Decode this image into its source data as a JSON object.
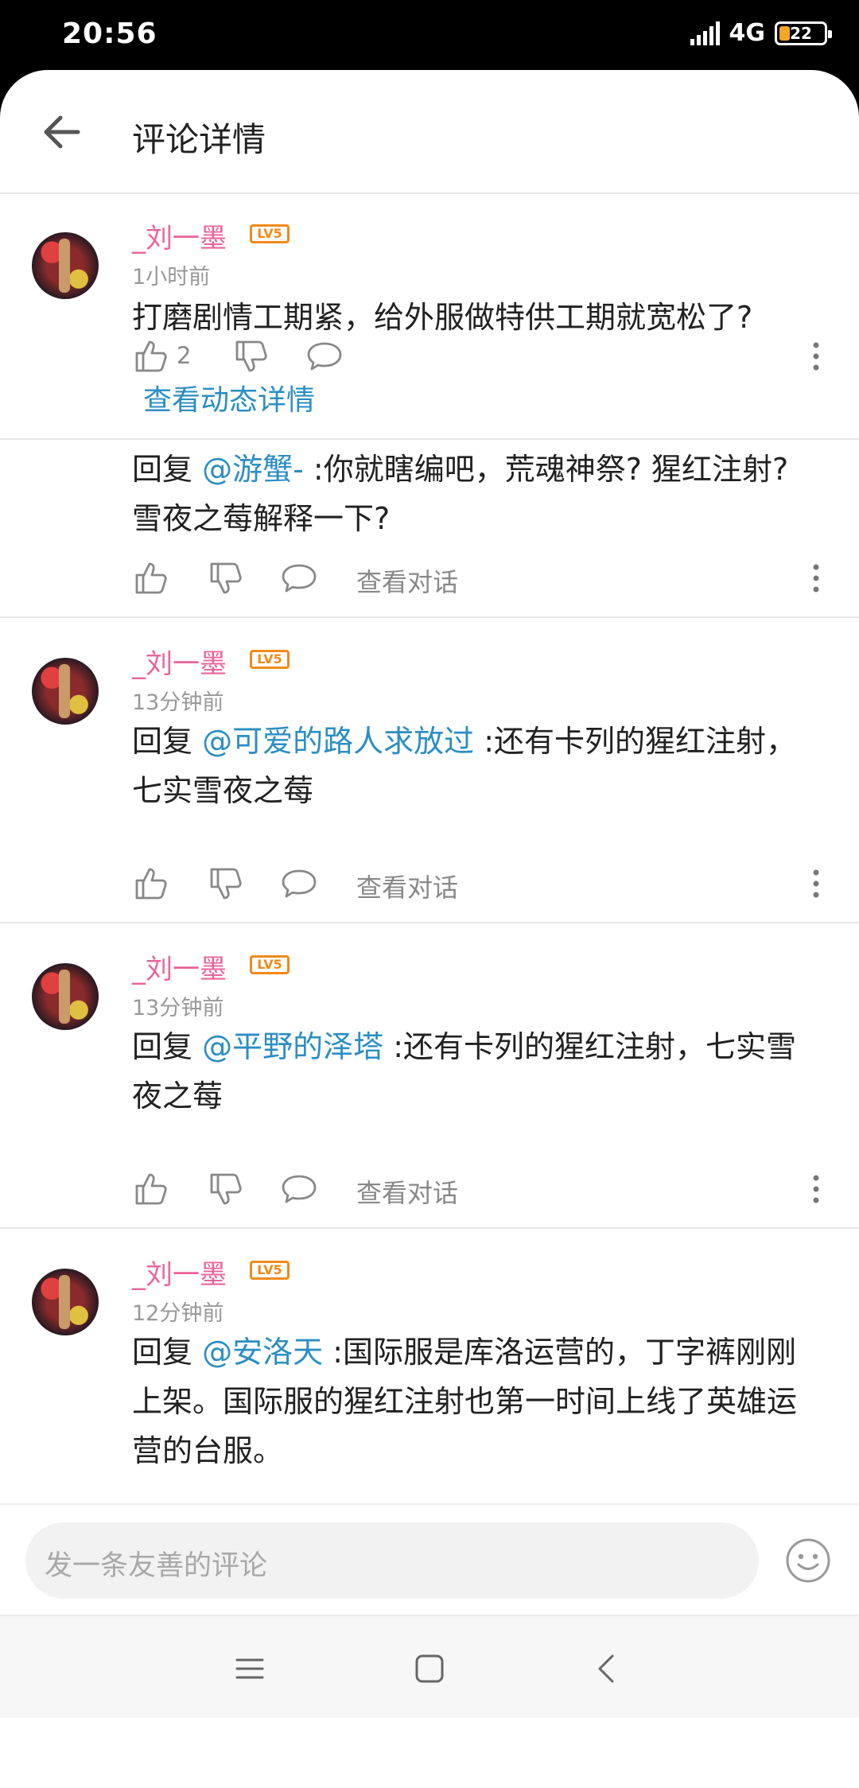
{
  "status": {
    "time": "20:56",
    "network": "4G",
    "battery": "22",
    "battery_fraction": 0.22
  },
  "header": {
    "title": "评论详情"
  },
  "main_comment": {
    "username": "_刘一墨",
    "level": "LV5",
    "time": "1小时前",
    "text": "打磨剧情工期紧，给外服做特供工期就宽松了?",
    "like_count": "2",
    "detail_link": "查看动态详情"
  },
  "replies": [
    {
      "prefix": "回复 ",
      "mention": "@游蟹-",
      "text": " :你就瞎编吧，荒魂神祭? 猩红注射? 雪夜之莓解释一下?",
      "talk_label": "查看对话"
    },
    {
      "username": "_刘一墨",
      "level": "LV5",
      "time": "13分钟前",
      "prefix": "回复 ",
      "mention": "@可爱的路人求放过",
      "text": " :还有卡列的猩红注射，七实雪夜之莓",
      "talk_label": "查看对话"
    },
    {
      "username": "_刘一墨",
      "level": "LV5",
      "time": "13分钟前",
      "prefix": "回复 ",
      "mention": "@平野的泽塔",
      "text": " :还有卡列的猩红注射，七实雪夜之莓",
      "talk_label": "查看对话"
    },
    {
      "username": "_刘一墨",
      "level": "LV5",
      "time": "12分钟前",
      "prefix": "回复 ",
      "mention": "@安洛天",
      "text": " :国际服是库洛运营的，丁字裤刚刚上架。国际服的猩红注射也第一时间上线了英雄运营的台服。",
      "talk_label": "查看对话"
    }
  ],
  "input": {
    "placeholder": "发一条友善的评论"
  },
  "colors": {
    "mention": "#2b8ec2",
    "username": "#e8649a",
    "level_badge": "#f08a1c"
  }
}
